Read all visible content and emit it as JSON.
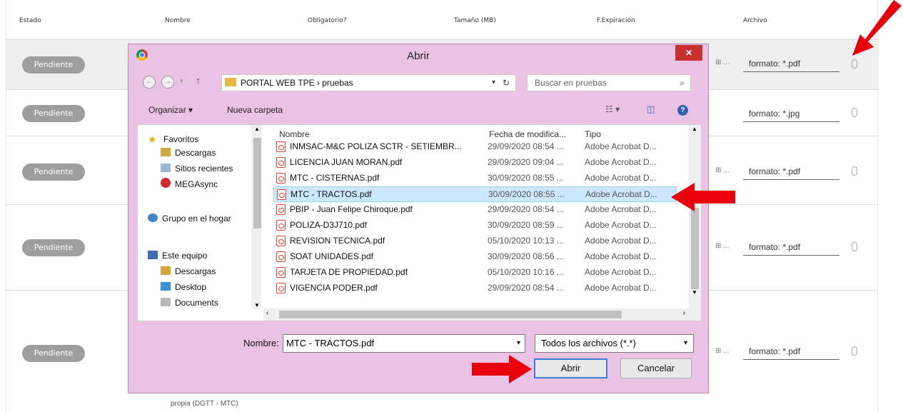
{
  "table": {
    "headers": [
      "Estado",
      "Nombre",
      "Obligatorio?",
      "Tamaño (MB)",
      "F.Expiración",
      "Archivo"
    ],
    "rows": [
      {
        "status": "Pendiente",
        "format": "formato: *.pdf"
      },
      {
        "status": "Pendiente",
        "format": "formato: *.jpg"
      },
      {
        "status": "Pendiente",
        "format": "formato: *.pdf"
      },
      {
        "status": "Pendiente",
        "format": "formato: *.pdf"
      },
      {
        "status": "Pendiente",
        "format": "formato: *.pdf"
      }
    ],
    "bottom_text": "propia (DGTT - MTC)"
  },
  "dialog": {
    "title": "Abrir",
    "close": "✕",
    "path": "PORTAL WEB TPE  ›  pruebas",
    "search_placeholder": "Buscar en pruebas",
    "organize": "Organizar ▾",
    "new_folder": "Nueva carpeta",
    "nav": {
      "favorites": "Favoritos",
      "downloads": "Descargas",
      "recent": "Sitios recientes",
      "mega": "MEGAsync",
      "homegroup": "Grupo en el hogar",
      "this_pc": "Este equipo",
      "pc_downloads": "Descargas",
      "desktop": "Desktop",
      "documents": "Documents"
    },
    "columns": {
      "name": "Nombre",
      "date": "Fecha de modifica...",
      "type": "Tipo"
    },
    "files": [
      {
        "name": "INMSAC-M&C POLIZA SCTR - SETIEMBR...",
        "date": "29/09/2020 08:54 ...",
        "type": "Adobe Acrobat D..."
      },
      {
        "name": "LICENCIA JUAN MORAN.pdf",
        "date": "29/09/2020 09:04 ...",
        "type": "Adobe Acrobat D..."
      },
      {
        "name": "MTC - CISTERNAS.pdf",
        "date": "30/09/2020 08:55 ...",
        "type": "Adobe Acrobat D..."
      },
      {
        "name": "MTC - TRACTOS.pdf",
        "date": "30/09/2020 08:55 ...",
        "type": "Adobe Acrobat D..."
      },
      {
        "name": "PBIP - Juan Felipe Chiroque.pdf",
        "date": "29/09/2020 08:54 ...",
        "type": "Adobe Acrobat D..."
      },
      {
        "name": "POLIZA-D3J710.pdf",
        "date": "30/09/2020 08:59 ...",
        "type": "Adobe Acrobat D..."
      },
      {
        "name": "REVISION TECNICA.pdf",
        "date": "05/10/2020 10:13 ...",
        "type": "Adobe Acrobat D..."
      },
      {
        "name": "SOAT UNIDADES.pdf",
        "date": "30/09/2020 08:56 ...",
        "type": "Adobe Acrobat D..."
      },
      {
        "name": "TARJETA DE PROPIEDAD.pdf",
        "date": "05/10/2020 10:16 ...",
        "type": "Adobe Acrobat D..."
      },
      {
        "name": "VIGENCIA PODER.pdf",
        "date": "29/09/2020 08:54 ...",
        "type": "Adobe Acrobat D..."
      }
    ],
    "selected_index": 3,
    "filename_label": "Nombre:",
    "filename_value": "MTC - TRACTOS.pdf",
    "filter_value": "Todos los archivos (*.*)",
    "open_label": "Abrir",
    "cancel_label": "Cancelar"
  },
  "colors": {
    "arrow": "#e8000b",
    "selected_row": "#cce8ff",
    "dialog_frame": "#e9c2e4",
    "status_pill": "#9e9e9e"
  }
}
